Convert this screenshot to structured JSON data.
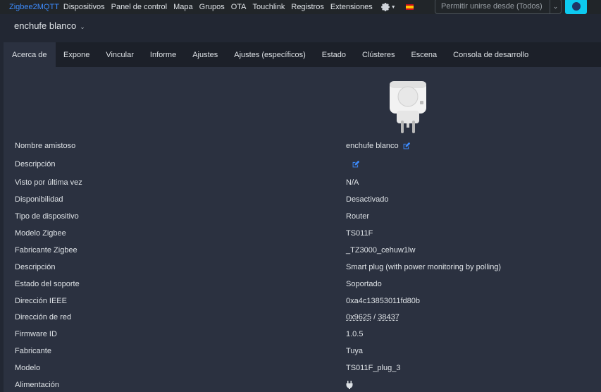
{
  "nav": {
    "brand": "Zigbee2MQTT",
    "items": [
      "Dispositivos",
      "Panel de control",
      "Mapa",
      "Grupos",
      "OTA",
      "Touchlink",
      "Registros",
      "Extensiones"
    ],
    "settings_icon": "gear-icon",
    "language_icon": "spain-flag-icon",
    "permit_join_label": "Permitir unirse desde (Todos)",
    "permit_join_icon": "zigbee-logo-icon"
  },
  "device": {
    "title": "enchufe blanco"
  },
  "tabs": [
    "Acerca de",
    "Expone",
    "Vincular",
    "Informe",
    "Ajustes",
    "Ajustes (específicos)",
    "Estado",
    "Clústeres",
    "Escena",
    "Consola de desarrollo"
  ],
  "active_tab": "Acerca de",
  "details": {
    "friendly_name": {
      "label": "Nombre amistoso",
      "value": "enchufe blanco"
    },
    "description": {
      "label": "Descripción",
      "value": ""
    },
    "last_seen": {
      "label": "Visto por última vez",
      "value": "N/A"
    },
    "availability": {
      "label": "Disponibilidad",
      "value": "Desactivado"
    },
    "device_type": {
      "label": "Tipo de dispositivo",
      "value": "Router"
    },
    "zigbee_model": {
      "label": "Modelo Zigbee",
      "value": "TS011F"
    },
    "zigbee_manufacturer": {
      "label": "Fabricante Zigbee",
      "value": "_TZ3000_cehuw1lw"
    },
    "model_description": {
      "label": "Descripción",
      "value": "Smart plug (with power monitoring by polling)"
    },
    "support_status": {
      "label": "Estado del soporte",
      "value": "Soportado"
    },
    "ieee_address": {
      "label": "Dirección IEEE",
      "value": "0xa4c13853011fd80b"
    },
    "network_address": {
      "label": "Dirección de red",
      "hex": "0x9625",
      "separator": " / ",
      "dec": "38437"
    },
    "firmware_id": {
      "label": "Firmware ID",
      "value": "1.0.5"
    },
    "manufacturer": {
      "label": "Fabricante",
      "value": "Tuya"
    },
    "model": {
      "label": "Modelo",
      "value": "TS011F_plug_3"
    },
    "power_source": {
      "label": "Alimentación",
      "icon": "plug-icon"
    }
  },
  "colors": {
    "background": "#222733",
    "panel": "#2b3140",
    "link": "#3d8bfd",
    "success": "#4bd37b",
    "accent_button": "#0dcaf0"
  }
}
